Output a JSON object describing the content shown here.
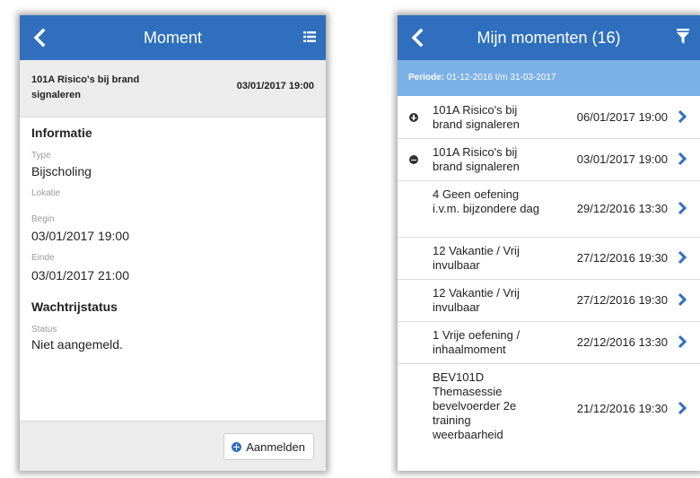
{
  "left": {
    "nav_title": "Moment",
    "moment": {
      "title": "101A Risico's bij brand signaleren",
      "date": "03/01/2017 19:00"
    },
    "informatie": {
      "heading": "Informatie",
      "type_label": "Type",
      "type_value": "Bijscholing",
      "lokatie_label": "Lokatie",
      "lokatie_value": "",
      "begin_label": "Begin",
      "begin_value": "03/01/2017 19:00",
      "einde_label": "Einde",
      "einde_value": "03/01/2017 21:00"
    },
    "wachtrij": {
      "heading": "Wachtrijstatus",
      "status_label": "Status",
      "status_value": "Niet aangemeld."
    },
    "register_label": "Aanmelden"
  },
  "right": {
    "nav_title": "Mijn momenten (16)",
    "periode_label": "Periode:",
    "periode_value": " 01-12-2016 t/m 31-03-2017",
    "rows": [
      {
        "title": "101A Risico's bij brand signaleren",
        "date": "06/01/2017 19:00",
        "icon": "plus-circle-icon"
      },
      {
        "title": "101A Risico's bij brand signaleren",
        "date": "03/01/2017 19:00",
        "icon": "minus-circle-icon"
      },
      {
        "title": "4 Geen oefening i.v.m. bijzondere dag",
        "date": "29/12/2016 13:30",
        "icon": ""
      },
      {
        "title": "12 Vakantie / Vrij invulbaar",
        "date": "27/12/2016 19:30",
        "icon": ""
      },
      {
        "title": "12 Vakantie / Vrij invulbaar",
        "date": "27/12/2016 19:30",
        "icon": ""
      },
      {
        "title": "1 Vrije oefening / inhaalmoment",
        "date": "22/12/2016 13:30",
        "icon": ""
      },
      {
        "title": "BEV101D Themasessie bevelvoerder 2e training weerbaarheid",
        "date": "21/12/2016 19:30",
        "icon": ""
      }
    ]
  },
  "colors": {
    "navbar": "#2f6fbd",
    "periode_bar": "#7cb1e6",
    "accent": "#2f6fbd"
  }
}
